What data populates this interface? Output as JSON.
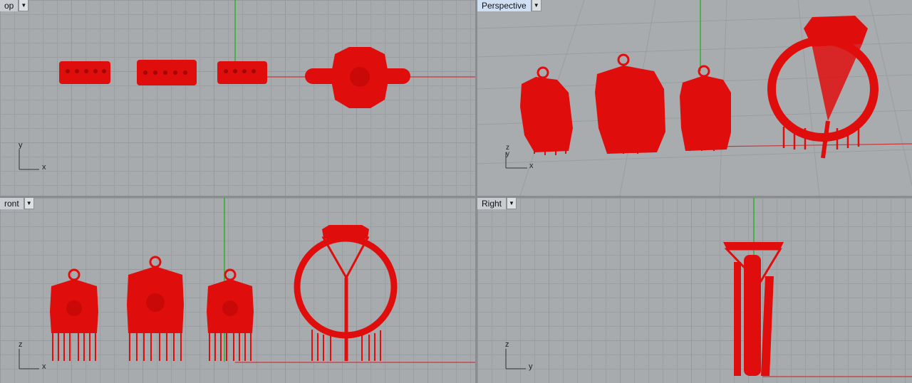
{
  "viewports": {
    "top": {
      "label": "Top",
      "visible_label": "op",
      "axes": [
        "y",
        "x"
      ]
    },
    "perspective": {
      "label": "Perspective",
      "axes": [
        "z",
        "y",
        "x"
      ]
    },
    "front": {
      "label": "Front",
      "visible_label": "ront",
      "axes": [
        "z",
        "x"
      ]
    },
    "right": {
      "label": "Right",
      "axes": [
        "z",
        "y"
      ]
    }
  },
  "colors": {
    "object": "#e00d0d",
    "object_dark": "#a50000",
    "grid_bg": "#a8abae",
    "y_axis": "#2fb02f",
    "x_axis": "#c43a3a"
  },
  "icons": {
    "dropdown": "triangle-down-icon"
  }
}
